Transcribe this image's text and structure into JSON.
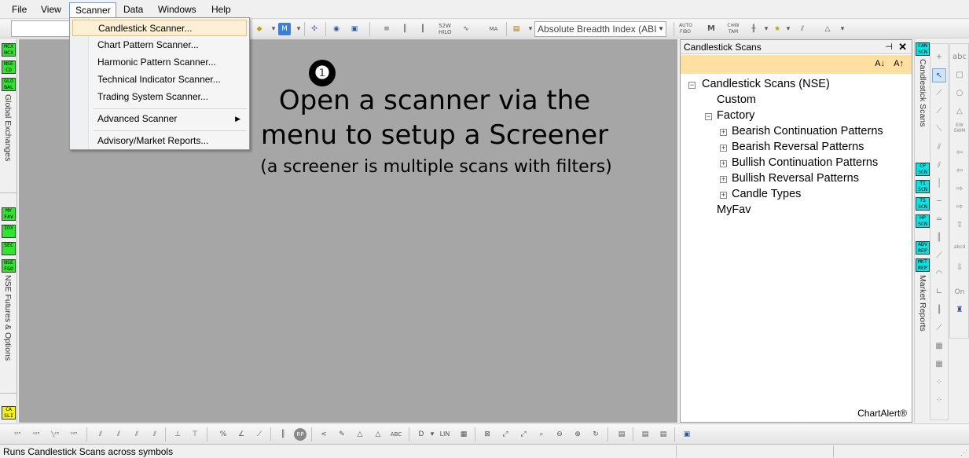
{
  "menubar": {
    "items": [
      "File",
      "View",
      "Scanner",
      "Data",
      "Windows",
      "Help"
    ],
    "active": "Scanner"
  },
  "toolbar": {
    "indicator_select": "Absolute Breadth Index (ABI"
  },
  "scanner_menu": {
    "items": [
      {
        "label": "Candlestick Scanner...",
        "highlighted": true
      },
      {
        "label": "Chart Pattern Scanner..."
      },
      {
        "label": "Harmonic Pattern Scanner..."
      },
      {
        "label": "Technical Indicator Scanner..."
      },
      {
        "label": "Trading System Scanner..."
      },
      {
        "label": "Advanced Scanner",
        "submenu": true
      },
      {
        "label": "Advisory/Market Reports..."
      }
    ]
  },
  "annotation": {
    "number": "❶",
    "line1": "Open a scanner via the",
    "line2": "menu to setup a Screener",
    "line3": "(a screener is multiple scans with filters)"
  },
  "left_strip": {
    "tags_top": [
      "MCX NCX",
      "NSE CD",
      "GLO BAL"
    ],
    "label_top": "Global Exchanges",
    "tags_mid": [
      "MY FAV",
      "IDX",
      "SEC",
      "NSE F&O"
    ],
    "label_mid": "NSE Futures & Options",
    "tag_bottom": "CA SLI"
  },
  "panel": {
    "title": "Candlestick Scans",
    "tree": {
      "root": "Candlestick Scans (NSE)",
      "custom": "Custom",
      "factory": "Factory",
      "factory_children": [
        "Bearish Continuation Patterns",
        "Bearish Reversal Patterns",
        "Bullish Continuation Patterns",
        "Bullish Reversal Patterns",
        "Candle Types"
      ],
      "myfav": "MyFav"
    },
    "brand": "ChartAlert®"
  },
  "right_strip": {
    "tags_top": [
      "CAN SCN"
    ],
    "label_top": "Candlestick Scans",
    "tags_mid": [
      "CP SCN",
      "TI SCN",
      "TS SCN",
      "HP SCN"
    ],
    "tags_low": [
      "ADV REP",
      "MKT REP"
    ],
    "label_low": "Market Reports"
  },
  "status": {
    "text": "Runs Candlestick Scans across symbols"
  },
  "colors": {
    "chart_bg": "#a6a6a6",
    "tag_green": "#2ee62e",
    "tag_cyan": "#00e5e5",
    "tag_yellow": "#f5f500",
    "menu_highlight": "#fdf0d5",
    "panel_toolbar": "#ffe0a0"
  }
}
